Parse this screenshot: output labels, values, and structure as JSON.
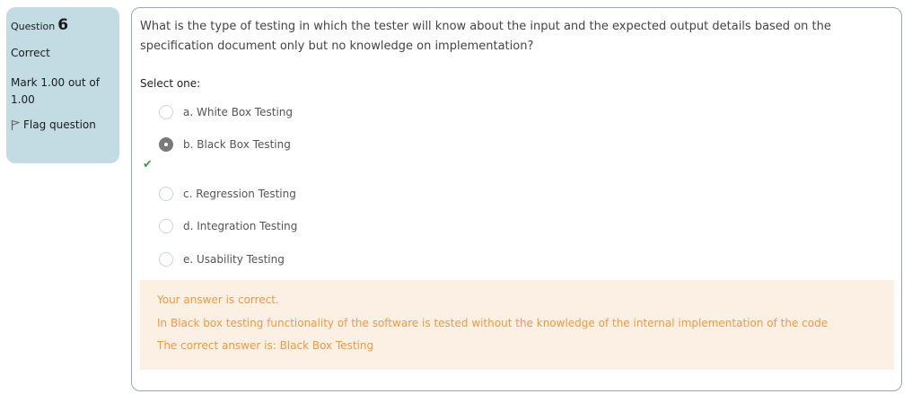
{
  "info": {
    "question_label": "Question",
    "question_number": "6",
    "state": "Correct",
    "grade": "Mark 1.00 out of 1.00",
    "flag_label": "Flag question"
  },
  "question": {
    "text": "What is the type of testing in which the tester will know about the input and the expected output details based on the specification document only but no knowledge on implementation?",
    "prompt": "Select one:",
    "options": [
      {
        "label": "a. White Box Testing",
        "selected": false
      },
      {
        "label": "b. Black Box Testing",
        "selected": true
      },
      {
        "label": "c. Regression Testing",
        "selected": false
      },
      {
        "label": "d. Integration Testing",
        "selected": false
      },
      {
        "label": "e. Usability Testing",
        "selected": false
      }
    ],
    "correct_mark": "✔"
  },
  "feedback": {
    "status": "Your answer is correct.",
    "explanation": "In Black box testing  functionality of the software is tested without the knowledge of the internal implementation of the code",
    "right_answer": "The correct answer is: Black Box Testing"
  },
  "colors": {
    "info_bg": "#c3dbe3",
    "feedback_bg": "#fcefe3",
    "feedback_text": "#ef9a44",
    "correct_check": "#3aa04d"
  }
}
